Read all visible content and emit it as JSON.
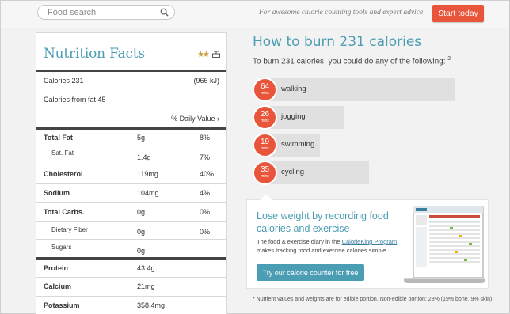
{
  "header": {
    "search_placeholder": "Food search",
    "tagline": "For awesome calorie counting tools and expert advice",
    "start_button": "Start today",
    "colors": {
      "accent": "#e8553a",
      "brand": "#4a9db2"
    }
  },
  "nutrition": {
    "title": "Nutrition Facts",
    "icons": [
      "rating-stars-icon",
      "scale-icon"
    ],
    "calories_label": "Calories 231",
    "calories_kj": "(966 kJ)",
    "calories_fat": "Calories from fat 45",
    "dv_label": "% Daily Value ›",
    "rows": [
      {
        "name": "Total Fat",
        "amount": "5g",
        "pct": "8%",
        "sub": false
      },
      {
        "name": "Sat. Fat",
        "amount": "1.4g",
        "pct": "7%",
        "sub": true
      },
      {
        "name": "Cholesterol",
        "amount": "119mg",
        "pct": "40%",
        "sub": false
      },
      {
        "name": "Sodium",
        "amount": "104mg",
        "pct": "4%",
        "sub": false
      },
      {
        "name": "Total Carbs.",
        "amount": "0g",
        "pct": "0%",
        "sub": false
      },
      {
        "name": "Dietary Fiber",
        "amount": "0g",
        "pct": "0%",
        "sub": true
      },
      {
        "name": "Sugars",
        "amount": "0g",
        "pct": "",
        "sub": true
      },
      {
        "name": "Protein",
        "amount": "43.4g",
        "pct": "",
        "sub": false
      },
      {
        "name": "Calcium",
        "amount": "21mg",
        "pct": "",
        "sub": false
      },
      {
        "name": "Potassium",
        "amount": "358.4mg",
        "pct": "",
        "sub": false
      }
    ]
  },
  "burn": {
    "title": "How to burn 231 calories",
    "subtitle": "To burn 231 calories, you could do any of the following:",
    "subtitle_ref": "2",
    "unit": "mins",
    "activities": [
      {
        "mins": "64",
        "label": "walking"
      },
      {
        "mins": "26",
        "label": "jogging"
      },
      {
        "mins": "19",
        "label": "swimming"
      },
      {
        "mins": "35",
        "label": "cycling"
      }
    ]
  },
  "promo": {
    "title": "Lose weight by recording food calories and exercise",
    "text_before": "The food & exercise diary in the ",
    "link": "CalorieKing Program",
    "text_after": " makes tracking food and exercise calories simple.",
    "button": "Try our calorie counter for free"
  },
  "footnote": "*  Nutrient values and weights are for edible portion. Non-edible portion: 28% (19% bone, 9% skin)"
}
